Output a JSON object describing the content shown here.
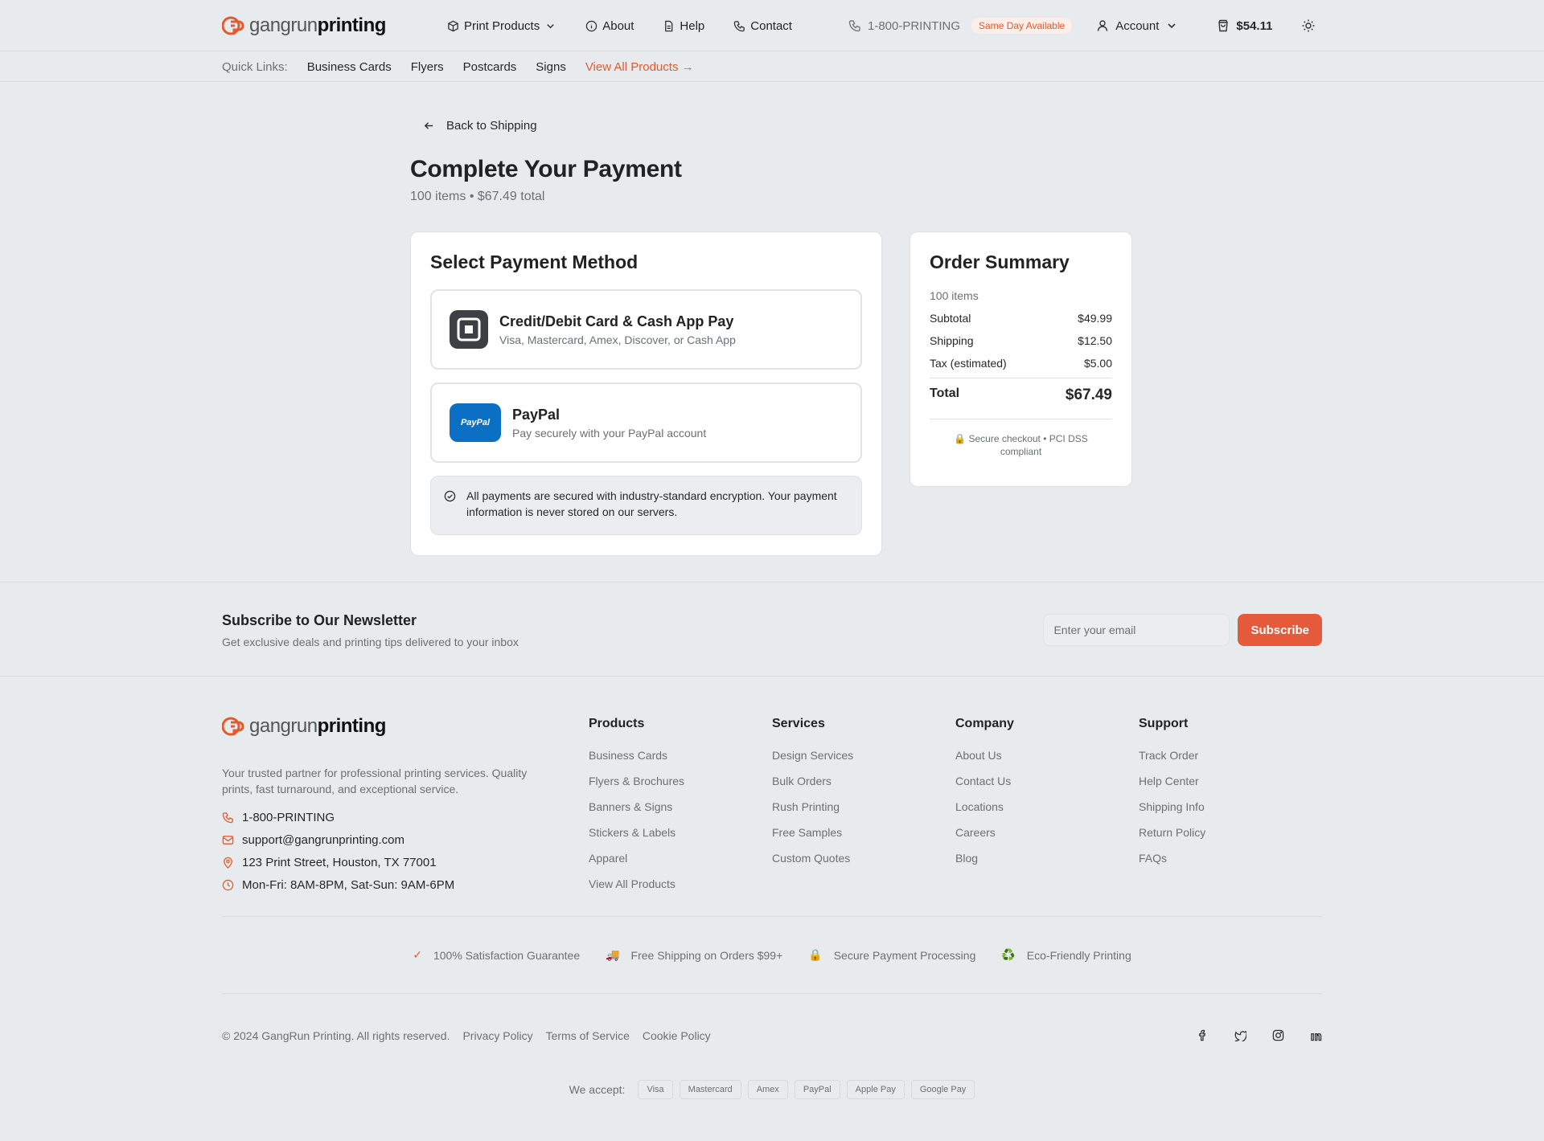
{
  "header": {
    "logo_a": "gangrun",
    "logo_b": "printing",
    "nav": [
      "Print Products",
      "About",
      "Help",
      "Contact"
    ],
    "phone": "1-800-PRINTING",
    "badge": "Same Day Available",
    "account": "Account",
    "cart_total": "$54.11"
  },
  "quick_links": {
    "label": "Quick Links:",
    "items": [
      "Business Cards",
      "Flyers",
      "Postcards",
      "Signs"
    ],
    "view_all": "View All Products →"
  },
  "page": {
    "back": "Back to Shipping",
    "title": "Complete Your Payment",
    "subtitle": "100 items • $67.49 total"
  },
  "payment": {
    "title": "Select Payment Method",
    "options": [
      {
        "title": "Credit/Debit Card & Cash App Pay",
        "desc": "Visa, Mastercard, Amex, Discover, or Cash App"
      },
      {
        "title": "PayPal",
        "desc": "Pay securely with your PayPal account",
        "logo": "PayPal"
      }
    ],
    "note": "All payments are secured with industry-standard encryption. Your payment information is never stored on our servers."
  },
  "summary": {
    "title": "Order Summary",
    "count": "100 items",
    "rows": [
      {
        "label": "Subtotal",
        "value": "$49.99"
      },
      {
        "label": "Shipping",
        "value": "$12.50"
      },
      {
        "label": "Tax (estimated)",
        "value": "$5.00"
      }
    ],
    "total_label": "Total",
    "total_value": "$67.49",
    "secure": "🔒 Secure checkout • PCI DSS compliant"
  },
  "newsletter": {
    "title": "Subscribe to Our Newsletter",
    "desc": "Get exclusive deals and printing tips delivered to your inbox",
    "placeholder": "Enter your email",
    "button": "Subscribe"
  },
  "footer": {
    "tagline": "Your trusted partner for professional printing services. Quality prints, fast turnaround, and exceptional service.",
    "contact": [
      "1-800-PRINTING",
      "support@gangrunprinting.com",
      "123 Print Street, Houston, TX 77001",
      "Mon-Fri: 8AM-8PM, Sat-Sun: 9AM-6PM"
    ],
    "columns": [
      {
        "title": "Products",
        "links": [
          "Business Cards",
          "Flyers & Brochures",
          "Banners & Signs",
          "Stickers & Labels",
          "Apparel",
          "View All Products"
        ]
      },
      {
        "title": "Services",
        "links": [
          "Design Services",
          "Bulk Orders",
          "Rush Printing",
          "Free Samples",
          "Custom Quotes"
        ]
      },
      {
        "title": "Company",
        "links": [
          "About Us",
          "Contact Us",
          "Locations",
          "Careers",
          "Blog"
        ]
      },
      {
        "title": "Support",
        "links": [
          "Track Order",
          "Help Center",
          "Shipping Info",
          "Return Policy",
          "FAQs"
        ]
      }
    ],
    "trust": [
      {
        "icon": "✓",
        "text": "100% Satisfaction Guarantee"
      },
      {
        "icon": "🚚",
        "text": "Free Shipping on Orders $99+"
      },
      {
        "icon": "🔒",
        "text": "Secure Payment Processing"
      },
      {
        "icon": "♻️",
        "text": "Eco-Friendly Printing"
      }
    ],
    "copyright": "© 2024 GangRun Printing. All rights reserved.",
    "legal": [
      "Privacy Policy",
      "Terms of Service",
      "Cookie Policy"
    ],
    "accept_label": "We accept:",
    "accept": [
      "Visa",
      "Mastercard",
      "Amex",
      "PayPal",
      "Apple Pay",
      "Google Pay"
    ]
  },
  "colors": {
    "accent": "#e55a3a",
    "paypal": "#0b6fc4",
    "background": "#e8ebee"
  }
}
